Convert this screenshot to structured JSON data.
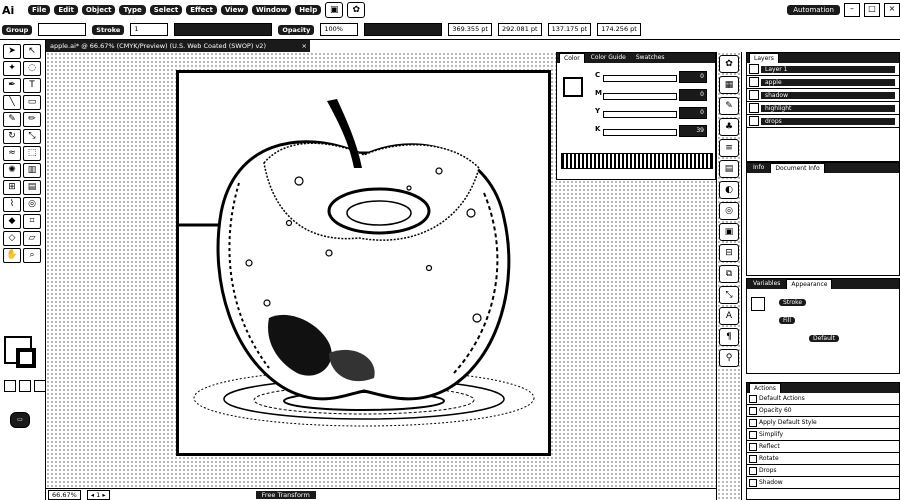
{
  "menubar": {
    "logo": "Ai",
    "items": [
      "File",
      "Edit",
      "Object",
      "Type",
      "Select",
      "Effect",
      "View",
      "Window",
      "Help"
    ],
    "workspace": "Automation"
  },
  "controlbar": {
    "selection_label": "Group",
    "stroke_label": "Stroke",
    "stroke_value": "1",
    "opacity_label": "Opacity",
    "opacity_value": "100%",
    "x_value": "369.355 pt",
    "y_value": "292.081 pt",
    "w_value": "137.175 pt",
    "h_value": "174.256 pt"
  },
  "document": {
    "tab_title": "apple.ai* @ 66.67% (CMYK/Preview) (U.S. Web Coated (SWOP) v2)",
    "zoom": "66.67%",
    "page": "1",
    "status_tool": "Free Transform"
  },
  "panels": {
    "color": {
      "tabs": [
        "Color",
        "Color Guide",
        "Swatches"
      ],
      "rows": [
        {
          "label": "C",
          "value": "0"
        },
        {
          "label": "M",
          "value": "0"
        },
        {
          "label": "Y",
          "value": "0"
        },
        {
          "label": "K",
          "value": "39"
        }
      ]
    },
    "layers": {
      "tabs": [
        "Layers"
      ],
      "items": [
        "Layer 1",
        "apple",
        "shadow",
        "highlight",
        "drops"
      ]
    },
    "docinfo": {
      "tabs": [
        "Info",
        "Document Info"
      ]
    },
    "variables": {
      "tabs": [
        "Variables",
        "Appearance"
      ],
      "items": [
        "Stroke",
        "Fill",
        "Default"
      ]
    },
    "actions": {
      "tabs": [
        "Actions"
      ],
      "items": [
        "Default Actions",
        "Opacity 60",
        "Apply Default Style",
        "Simplify",
        "Reflect",
        "Rotate",
        "Drops",
        "Shadow"
      ]
    }
  }
}
